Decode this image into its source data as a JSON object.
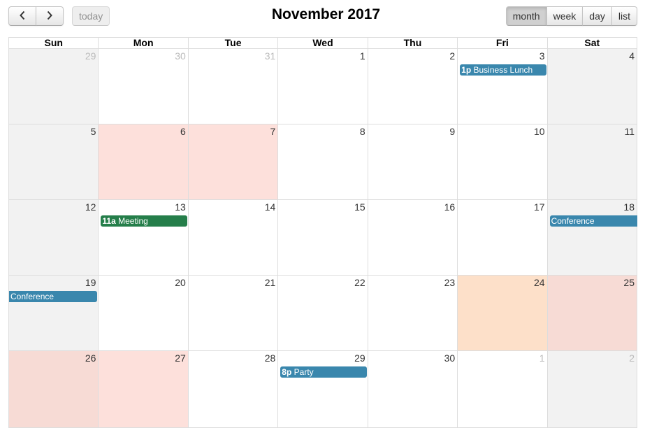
{
  "toolbar": {
    "prev_icon": "chevron-left-icon",
    "next_icon": "chevron-right-icon",
    "today_label": "today",
    "title": "November 2017",
    "views": [
      {
        "label": "month",
        "active": true
      },
      {
        "label": "week",
        "active": false
      },
      {
        "label": "day",
        "active": false
      },
      {
        "label": "list",
        "active": false
      }
    ]
  },
  "colors": {
    "event_default": "#3a87ad",
    "event_green": "#257e4a",
    "highlight_pink": "#fde0db",
    "highlight_peach": "#fde0c9",
    "highlight_rose": "#f7dbd5",
    "weekend_gray": "#f2f2f2"
  },
  "weekdays": [
    "Sun",
    "Mon",
    "Tue",
    "Wed",
    "Thu",
    "Fri",
    "Sat"
  ],
  "weeks": [
    {
      "days": [
        {
          "num": "29",
          "other": true
        },
        {
          "num": "30",
          "other": true
        },
        {
          "num": "31",
          "other": true
        },
        {
          "num": "1"
        },
        {
          "num": "2"
        },
        {
          "num": "3"
        },
        {
          "num": "4"
        }
      ],
      "events": [
        {
          "col": 6,
          "span": 1,
          "time": "1p",
          "title": "Business Lunch",
          "color": "blue"
        }
      ]
    },
    {
      "days": [
        {
          "num": "5"
        },
        {
          "num": "6",
          "bg": "pink"
        },
        {
          "num": "7",
          "bg": "pink"
        },
        {
          "num": "8"
        },
        {
          "num": "9"
        },
        {
          "num": "10"
        },
        {
          "num": "11"
        }
      ],
      "events": []
    },
    {
      "days": [
        {
          "num": "12"
        },
        {
          "num": "13"
        },
        {
          "num": "14"
        },
        {
          "num": "15"
        },
        {
          "num": "16"
        },
        {
          "num": "17"
        },
        {
          "num": "18"
        }
      ],
      "events": [
        {
          "col": 2,
          "span": 1,
          "time": "11a",
          "title": "Meeting",
          "color": "green"
        },
        {
          "col": 7,
          "span": 1,
          "time": "",
          "title": "Conference",
          "color": "blue",
          "cont": "right"
        }
      ]
    },
    {
      "days": [
        {
          "num": "19"
        },
        {
          "num": "20"
        },
        {
          "num": "21"
        },
        {
          "num": "22"
        },
        {
          "num": "23"
        },
        {
          "num": "24",
          "bg": "peach"
        },
        {
          "num": "25",
          "bg": "rose"
        }
      ],
      "events": [
        {
          "col": 1,
          "span": 1,
          "time": "",
          "title": "Conference",
          "color": "blue",
          "cont": "left"
        }
      ]
    },
    {
      "days": [
        {
          "num": "26",
          "bg": "rose"
        },
        {
          "num": "27",
          "bg": "pink"
        },
        {
          "num": "28"
        },
        {
          "num": "29"
        },
        {
          "num": "30"
        },
        {
          "num": "1",
          "other": true
        },
        {
          "num": "2",
          "other": true
        }
      ],
      "events": [
        {
          "col": 4,
          "span": 1,
          "time": "8p",
          "title": "Party",
          "color": "blue"
        }
      ]
    }
  ]
}
